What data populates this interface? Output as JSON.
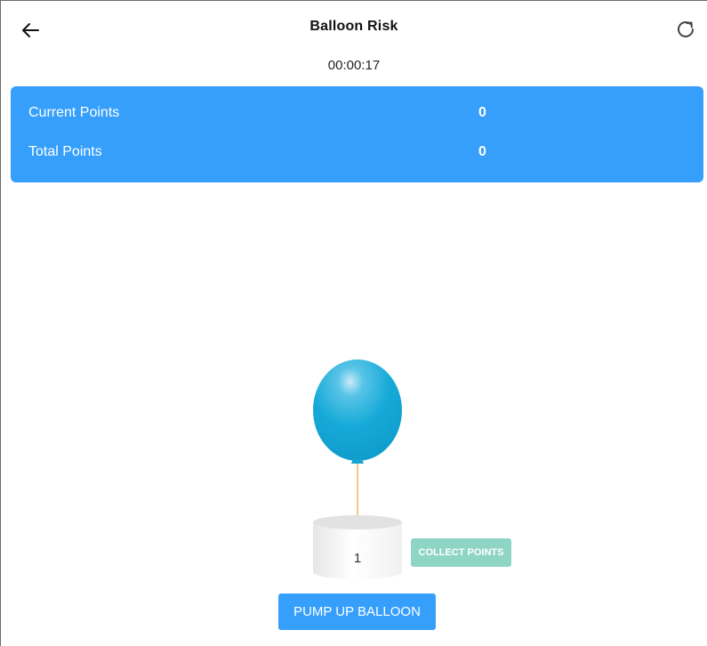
{
  "header": {
    "title": "Balloon Risk",
    "back_icon": "arrow-left-icon",
    "reload_icon": "reload-icon"
  },
  "timer": "00:00:17",
  "points": {
    "current_label": "Current Points",
    "current_value": "0",
    "total_label": "Total Points",
    "total_value": "0"
  },
  "balloon": {
    "pump_count": "1",
    "color": "#12a9d6"
  },
  "actions": {
    "collect_label": "COLLECT POINTS",
    "pump_label": "PUMP UP BALLOON"
  },
  "colors": {
    "primary": "#369ffc",
    "collect_disabled": "#8fd5c6",
    "string": "#f0c98c"
  }
}
